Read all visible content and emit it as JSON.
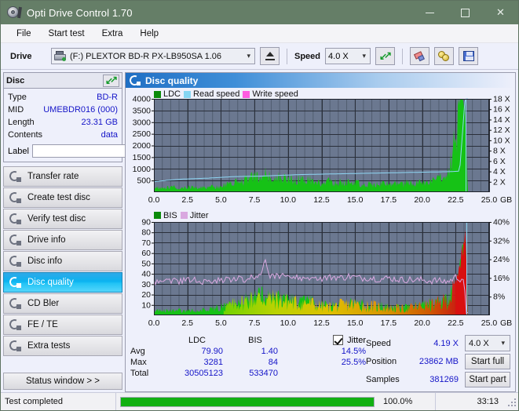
{
  "window": {
    "title": "Opti Drive Control 1.70",
    "minimize": "—",
    "maximize": "",
    "close": "✕"
  },
  "menu": {
    "items": [
      "File",
      "Start test",
      "Extra",
      "Help"
    ]
  },
  "toolbar": {
    "drive_label": "Drive",
    "drive_value": "(F:)  PLEXTOR BD-R  PX-LB950SA 1.06",
    "eject_icon": "eject-icon",
    "speed_label": "Speed",
    "speed_value": "4.0 X",
    "refresh_icon": "refresh-arrows-icon",
    "erase_icon": "eraser-icon",
    "gold_icon": "two-discs-icon",
    "save_icon": "floppy-save-icon"
  },
  "disc_panel": {
    "title": "Disc",
    "refresh_icon": "refresh-arrows-icon",
    "rows": [
      {
        "key": "Type",
        "value": "BD-R"
      },
      {
        "key": "MID",
        "value": "UMEBDR016 (000)"
      },
      {
        "key": "Length",
        "value": "23.31 GB"
      },
      {
        "key": "Contents",
        "value": "data"
      }
    ],
    "label_key": "Label",
    "label_value": "",
    "label_placeholder": "",
    "label_button_icon": "disc-icon"
  },
  "sidebar": {
    "items": [
      {
        "label": "Transfer rate",
        "icon": "disc-arrow-icon",
        "selected": false
      },
      {
        "label": "Create test disc",
        "icon": "disc-write-icon",
        "selected": false
      },
      {
        "label": "Verify test disc",
        "icon": "disc-check-icon",
        "selected": false
      },
      {
        "label": "Drive info",
        "icon": "drive-info-icon",
        "selected": false
      },
      {
        "label": "Disc info",
        "icon": "disc-info-icon",
        "selected": false
      },
      {
        "label": "Disc quality",
        "icon": "disc-quality-icon",
        "selected": true
      },
      {
        "label": "CD Bler",
        "icon": "disc-bler-icon",
        "selected": false
      },
      {
        "label": "FE / TE",
        "icon": "disc-fete-icon",
        "selected": false
      },
      {
        "label": "Extra tests",
        "icon": "disc-extra-icon",
        "selected": false
      }
    ],
    "status_window": "Status window > >"
  },
  "content": {
    "header": "Disc quality",
    "header_icon": "disc-quality-icon"
  },
  "chart_data": [
    {
      "id": "top",
      "type": "area",
      "title": "",
      "legend": [
        {
          "name": "LDC",
          "color": "#0a8a0a"
        },
        {
          "name": "Read speed",
          "color": "#86d6f2"
        },
        {
          "name": "Write speed",
          "color": "#ff5ce0"
        }
      ],
      "xlabel": "GB",
      "xlim": [
        0,
        25
      ],
      "xticks": [
        "0.0",
        "2.5",
        "5.0",
        "7.5",
        "10.0",
        "12.5",
        "15.0",
        "17.5",
        "20.0",
        "22.5",
        "25.0"
      ],
      "ylabel_left": "LDC",
      "ylim": [
        0,
        4000
      ],
      "yticks": [
        "4000",
        "3500",
        "3000",
        "2500",
        "2000",
        "1500",
        "1000",
        "500"
      ],
      "ylabel_right": "Speed",
      "ylim_right": [
        0,
        18
      ],
      "yticks_right": [
        "18 X",
        "16 X",
        "14 X",
        "12 X",
        "10 X",
        "8 X",
        "6 X",
        "4 X",
        "2 X"
      ],
      "grid": true,
      "plot_bg": "#6b7890",
      "series": [
        {
          "name": "LDC",
          "color": "#16c216",
          "x": [
            0.0,
            0.3,
            0.6,
            0.9,
            1.2,
            1.5,
            1.8,
            2.1,
            2.4,
            2.7,
            3.0,
            3.3,
            3.6,
            3.9,
            4.2,
            4.5,
            4.8,
            5.1,
            5.4,
            5.7,
            6.0,
            6.3,
            6.6,
            6.9,
            7.2,
            7.5,
            7.8,
            8.1,
            8.4,
            8.7,
            9.0,
            9.3,
            9.6,
            9.9,
            10.2,
            10.5,
            10.8,
            11.1,
            11.4,
            11.7,
            12.0,
            12.3,
            12.6,
            12.9,
            13.2,
            13.5,
            13.8,
            14.1,
            14.4,
            14.7,
            15.0,
            15.3,
            15.6,
            15.9,
            16.2,
            16.5,
            16.8,
            17.1,
            17.4,
            17.7,
            18.0,
            18.3,
            18.6,
            18.9,
            19.2,
            19.5,
            19.8,
            20.1,
            20.4,
            20.7,
            21.0,
            21.3,
            21.6,
            21.9,
            22.2,
            22.5,
            22.8,
            23.0,
            23.15,
            23.3,
            23.4
          ],
          "y": [
            150,
            170,
            140,
            190,
            160,
            200,
            150,
            180,
            160,
            210,
            180,
            170,
            190,
            160,
            200,
            230,
            210,
            260,
            300,
            330,
            380,
            430,
            470,
            520,
            620,
            700,
            660,
            640,
            700,
            620,
            560,
            600,
            540,
            520,
            560,
            500,
            520,
            470,
            500,
            460,
            440,
            420,
            400,
            430,
            390,
            410,
            380,
            400,
            360,
            380,
            350,
            370,
            340,
            360,
            330,
            350,
            320,
            340,
            330,
            350,
            320,
            340,
            330,
            360,
            340,
            380,
            360,
            400,
            380,
            420,
            450,
            520,
            600,
            800,
            1400,
            2600,
            4000,
            4000,
            4000,
            2000,
            0
          ]
        },
        {
          "name": "Read speed",
          "color": "#8fd8f5",
          "x": [
            0.0,
            1.0,
            2.0,
            3.0,
            4.0,
            5.0,
            6.0,
            7.0,
            8.0,
            9.0,
            10.0,
            11.0,
            12.0,
            13.0,
            14.0,
            15.0,
            16.0,
            17.0,
            18.0,
            19.0,
            20.0,
            21.0,
            22.0,
            22.8,
            23.2,
            23.3
          ],
          "y": [
            2.0,
            2.3,
            2.5,
            2.6,
            2.7,
            2.85,
            3.0,
            3.05,
            3.1,
            3.2,
            3.3,
            3.4,
            3.45,
            3.5,
            3.55,
            3.6,
            3.65,
            3.7,
            3.75,
            3.8,
            3.85,
            3.9,
            3.95,
            4.05,
            18.0,
            18.0
          ]
        }
      ]
    },
    {
      "id": "bottom",
      "type": "area",
      "title": "",
      "legend": [
        {
          "name": "BIS",
          "color": "#0a8a0a"
        },
        {
          "name": "Jitter",
          "color": "#d9a8e0"
        }
      ],
      "xlabel": "GB",
      "xlim": [
        0,
        25
      ],
      "xticks": [
        "0.0",
        "2.5",
        "5.0",
        "7.5",
        "10.0",
        "12.5",
        "15.0",
        "17.5",
        "20.0",
        "22.5",
        "25.0"
      ],
      "ylabel_left": "BIS",
      "ylim": [
        0,
        90
      ],
      "yticks": [
        "90",
        "80",
        "70",
        "60",
        "50",
        "40",
        "30",
        "20",
        "10"
      ],
      "ylabel_right": "Jitter",
      "ylim_right": [
        0,
        40
      ],
      "yticks_right": [
        "40%",
        "32%",
        "24%",
        "16%",
        "8%"
      ],
      "grid": true,
      "plot_bg": "#6b7890",
      "series": [
        {
          "name": "BIS",
          "color": "#16c216",
          "x": [
            0.0,
            0.5,
            1.0,
            1.5,
            2.0,
            2.5,
            3.0,
            3.5,
            4.0,
            4.5,
            5.0,
            5.5,
            6.0,
            6.5,
            7.0,
            7.5,
            8.0,
            8.5,
            9.0,
            9.5,
            10.0,
            10.5,
            11.0,
            11.5,
            12.0,
            12.5,
            13.0,
            13.5,
            14.0,
            14.5,
            15.0,
            15.5,
            16.0,
            16.5,
            17.0,
            17.5,
            18.0,
            18.5,
            19.0,
            19.5,
            20.0,
            20.5,
            21.0,
            21.5,
            22.0,
            22.4,
            22.7,
            23.0,
            23.2,
            23.35,
            23.4
          ],
          "y": [
            6,
            5,
            5,
            4,
            5,
            4,
            5,
            5,
            6,
            7,
            8,
            10,
            12,
            14,
            16,
            18,
            19,
            18,
            17,
            16,
            15,
            14,
            13,
            14,
            12,
            10,
            9,
            10,
            11,
            12,
            12,
            11,
            10,
            10,
            9,
            8,
            8,
            7,
            8,
            9,
            10,
            11,
            12,
            14,
            18,
            26,
            40,
            62,
            75,
            40,
            0
          ]
        },
        {
          "name": "Jitter",
          "color": "#d9a8e0",
          "x": [
            0.0,
            0.5,
            1.0,
            1.5,
            2.0,
            2.5,
            3.0,
            3.5,
            4.0,
            4.5,
            5.0,
            5.5,
            6.0,
            6.5,
            7.0,
            7.5,
            8.0,
            8.3,
            8.6,
            9.0,
            9.5,
            10.0,
            10.5,
            11.0,
            11.5,
            12.0,
            12.5,
            13.0,
            13.5,
            14.0,
            14.5,
            15.0,
            15.5,
            16.0,
            16.5,
            17.0,
            17.5,
            18.0,
            18.5,
            19.0,
            19.5,
            20.0,
            20.5,
            21.0,
            21.5,
            22.0,
            22.5,
            22.9,
            23.1,
            23.3
          ],
          "y": [
            14.0,
            14.5,
            15.0,
            14.8,
            14.6,
            14.9,
            15.1,
            14.7,
            14.5,
            14.9,
            15.2,
            15.0,
            16.2,
            15.5,
            15.8,
            16.0,
            18.5,
            25.5,
            17.5,
            16.5,
            16.8,
            16.2,
            16.0,
            15.8,
            16.5,
            16.0,
            15.8,
            16.2,
            16.5,
            16.0,
            16.8,
            16.3,
            15.9,
            16.2,
            15.8,
            15.5,
            16.0,
            15.6,
            15.2,
            15.4,
            15.0,
            15.2,
            14.8,
            14.9,
            14.6,
            14.5,
            16.5,
            15.5,
            16.0,
            0
          ]
        }
      ]
    }
  ],
  "stats": {
    "headers": {
      "ldc": "LDC",
      "bis": "BIS",
      "jitter": "Jitter"
    },
    "jitter_checked": true,
    "rows": [
      {
        "key": "Avg",
        "ldc": "79.90",
        "bis": "1.40",
        "jitter": "14.5%"
      },
      {
        "key": "Max",
        "ldc": "3281",
        "bis": "84",
        "jitter": "25.5%"
      },
      {
        "key": "Total",
        "ldc": "30505123",
        "bis": "533470",
        "jitter": ""
      }
    ],
    "speed_key": "Speed",
    "speed_value": "4.19 X",
    "speed_select": "4.0 X",
    "position_key": "Position",
    "position_value": "23862 MB",
    "samples_key": "Samples",
    "samples_value": "381269",
    "start_full": "Start full",
    "start_part": "Start part"
  },
  "statusbar": {
    "message": "Test completed",
    "progress_percent": "100.0%",
    "progress_value": 100,
    "elapsed": "33:13"
  }
}
